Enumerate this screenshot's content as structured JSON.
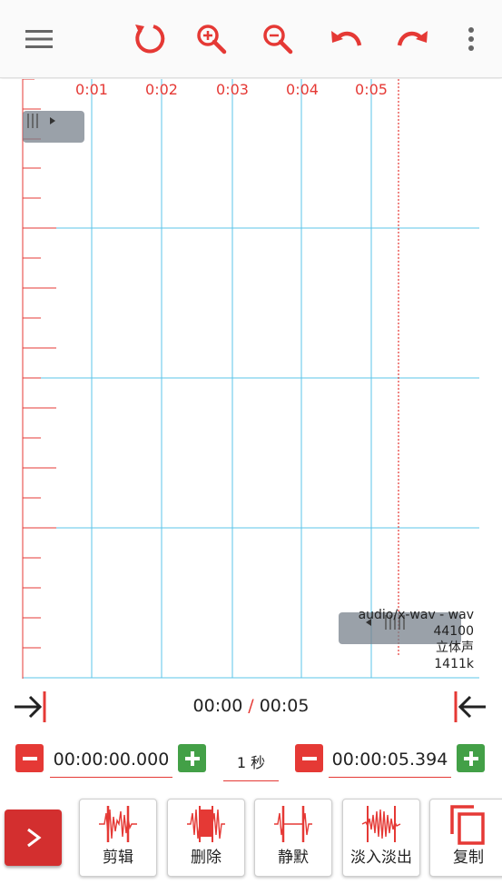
{
  "colors": {
    "accent": "#e53935",
    "grid": "#5bc4ea",
    "green": "#43a047",
    "handle": "#7a828c"
  },
  "toolbar": {
    "icons": [
      "menu-icon",
      "reload-icon",
      "zoom-in-icon",
      "zoom-out-icon",
      "undo-icon",
      "redo-icon",
      "more-vert-icon"
    ]
  },
  "timeline": {
    "ticks": [
      "0:01",
      "0:02",
      "0:03",
      "0:04",
      "0:05"
    ]
  },
  "file_info": {
    "mime": "audio/x-wav - wav",
    "sample_rate": "44100",
    "channels": "立体声",
    "bitrate": "1411k"
  },
  "playback": {
    "current": "00:00",
    "separator": "/",
    "total": "00:05"
  },
  "selection": {
    "start": "00:00:00.000",
    "step": "1 秒",
    "end": "00:00:05.394"
  },
  "actions": [
    {
      "label": "剪辑",
      "icon": "trim-icon"
    },
    {
      "label": "删除",
      "icon": "delete-region-icon"
    },
    {
      "label": "静默",
      "icon": "silence-icon"
    },
    {
      "label": "淡入淡出",
      "icon": "fade-icon"
    },
    {
      "label": "复制",
      "icon": "copy-icon"
    }
  ]
}
